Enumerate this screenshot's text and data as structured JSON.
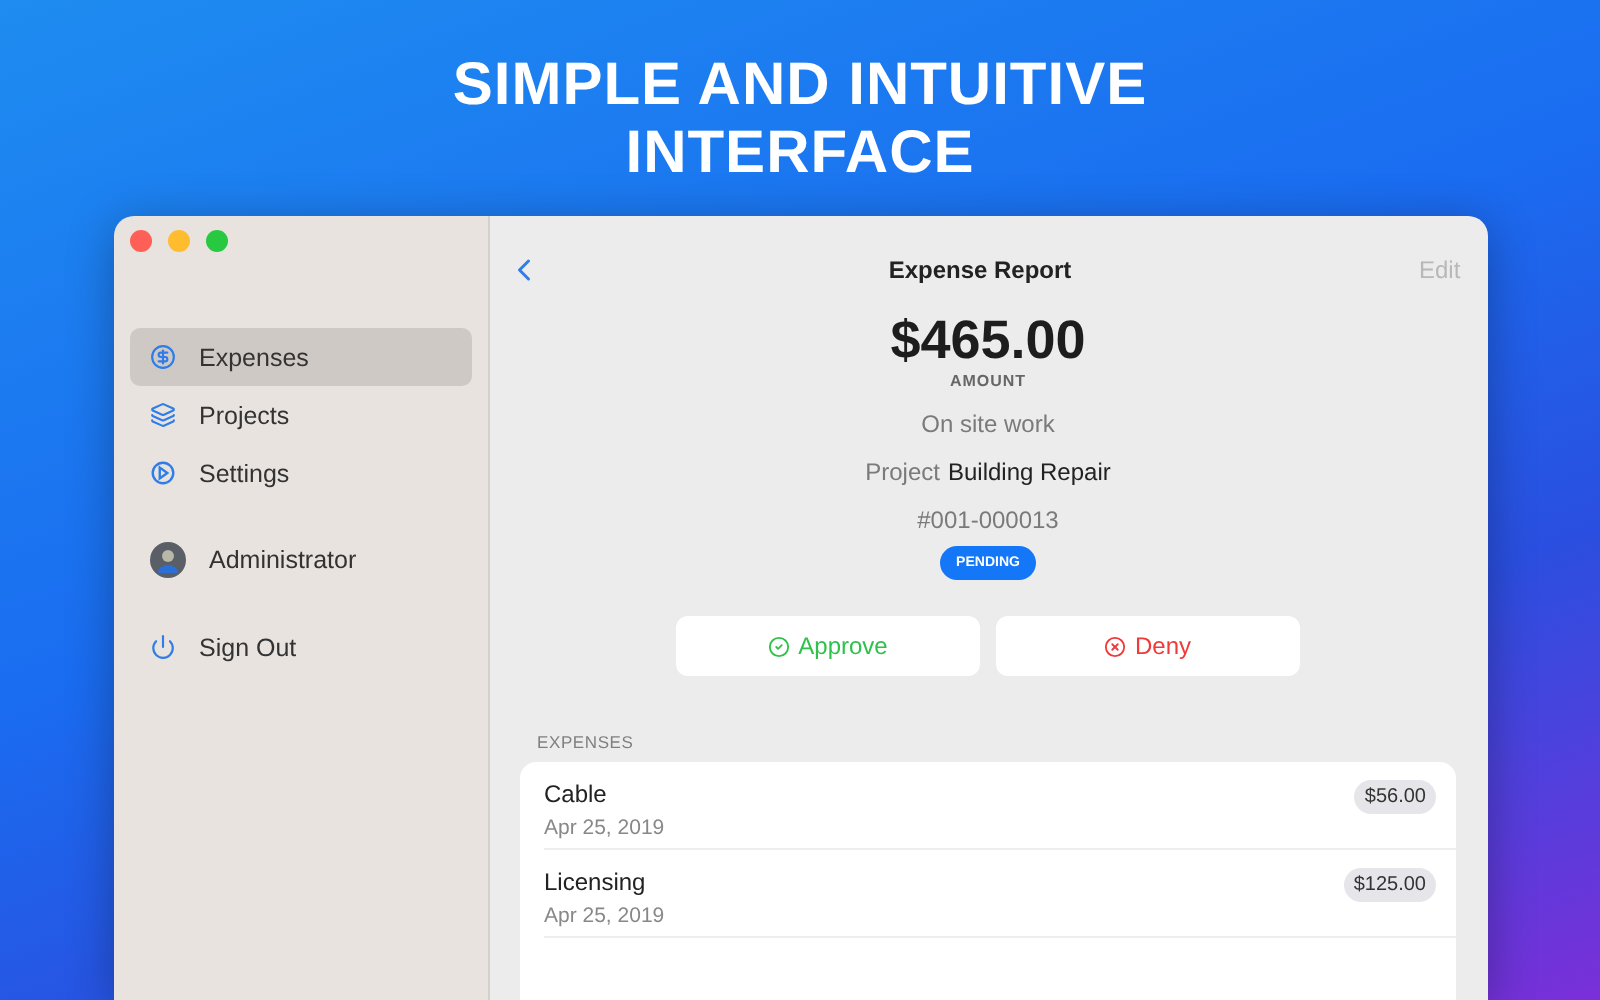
{
  "headline": "SIMPLE AND INTUITIVE INTERFACE",
  "sidebar": {
    "items": [
      {
        "label": "Expenses",
        "kind": "dollar",
        "selected": true
      },
      {
        "label": "Projects",
        "kind": "layers",
        "selected": false
      },
      {
        "label": "Settings",
        "kind": "gauge",
        "selected": false
      }
    ],
    "user": {
      "name": "Administrator"
    },
    "sign_out": "Sign Out"
  },
  "header": {
    "title": "Expense Report",
    "edit": "Edit"
  },
  "report": {
    "amount": "$465.00",
    "amount_label": "AMOUNT",
    "description": "On site work",
    "project_label": "Project",
    "project": "Building Repair",
    "number": "#001-000013",
    "status": "PENDING"
  },
  "actions": [
    {
      "label": "Approve",
      "kind": "approve"
    },
    {
      "label": "Deny",
      "kind": "deny"
    }
  ],
  "expenses": {
    "heading": "EXPENSES",
    "rows": [
      {
        "name": "Cable",
        "date": "Apr 25, 2019",
        "amount": "$56.00"
      },
      {
        "name": "Licensing",
        "date": "Apr 25, 2019",
        "amount": "$125.00"
      }
    ]
  }
}
